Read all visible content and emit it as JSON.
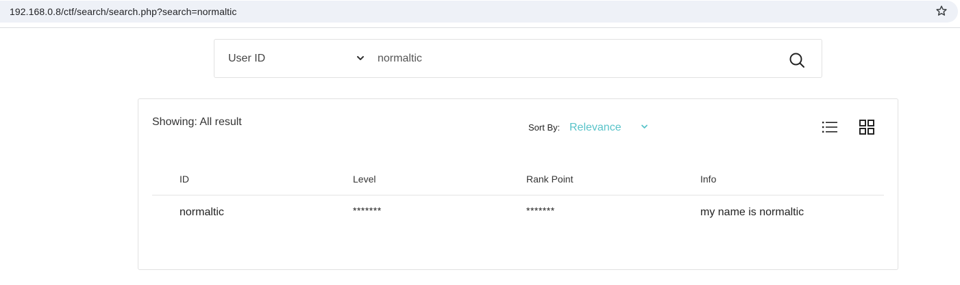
{
  "browser": {
    "url": "192.168.0.8/ctf/search/search.php?search=normaltic",
    "bookmark_icon": "star-icon"
  },
  "search": {
    "field_select": "User ID",
    "query": "normaltic",
    "search_icon": "search-icon"
  },
  "results": {
    "showing_label": "Showing: All result",
    "sort_by_label": "Sort By:",
    "sort_by_value": "Relevance",
    "accent_color": "#58c3c9",
    "view_icons": [
      "list-view-icon",
      "grid-view-icon"
    ],
    "columns": [
      "ID",
      "Level",
      "Rank Point",
      "Info"
    ],
    "rows": [
      {
        "id": "normaltic",
        "level": "*******",
        "rank_point": "*******",
        "info": "my name is normaltic"
      }
    ]
  }
}
